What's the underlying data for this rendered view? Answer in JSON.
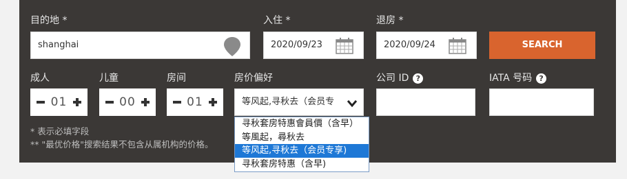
{
  "labels": {
    "destination": "目的地 *",
    "checkin": "入住 *",
    "checkout": "退房 *",
    "adults": "成人",
    "children": "儿童",
    "rooms": "房间",
    "rate_preference": "房价偏好",
    "company_id": "公司 ID",
    "iata": "IATA 号码"
  },
  "destination": {
    "value": "shanghai",
    "icon": "map-pin-icon"
  },
  "checkin": {
    "value": "2020/09/23",
    "icon": "calendar-icon"
  },
  "checkout": {
    "value": "2020/09/24",
    "icon": "calendar-icon"
  },
  "search_button": "SEARCH",
  "adults": {
    "value": "01"
  },
  "children": {
    "value": "00"
  },
  "rooms": {
    "value": "01"
  },
  "rate_select": {
    "value": "等风起,寻秋去（会员专",
    "icon": "chevron-down-icon"
  },
  "help_icon": "?",
  "notes": {
    "required": "* 表示必填字段",
    "price": "** \"最优价格\"搜索结果不包含从属机构的价格。"
  },
  "dropdown_options": [
    "寻秋套房特惠會員價（含早）",
    "等風起，尋秋去",
    "等风起,寻秋去（会员专享)",
    "寻秋套房特惠（含早)"
  ],
  "colors": {
    "panel": "#3b3836",
    "accent": "#d9642e",
    "selected_option": "#1e78d6"
  }
}
